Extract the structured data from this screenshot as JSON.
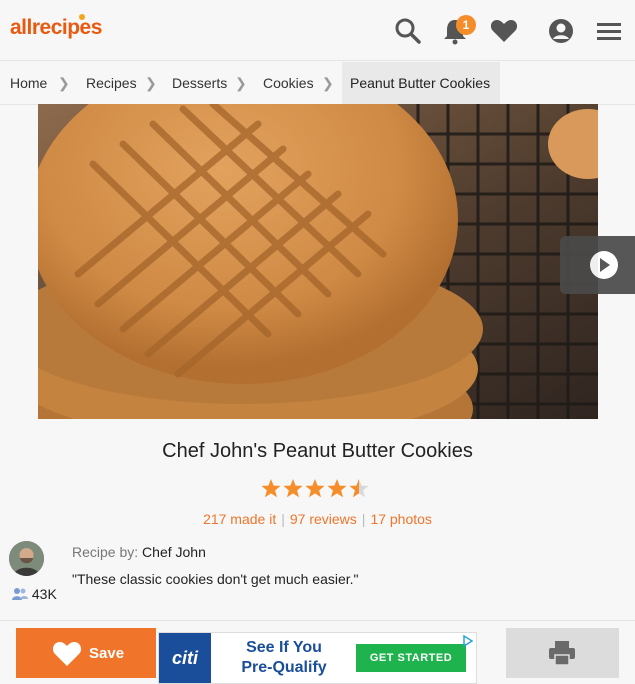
{
  "header": {
    "logo_text": "allrecipes",
    "notification_count": "1",
    "icons": [
      "search-icon",
      "bell-icon",
      "heart-icon",
      "user-icon",
      "menu-icon"
    ]
  },
  "breadcrumbs": {
    "items": [
      "Home",
      "Recipes",
      "Desserts",
      "Cookies"
    ],
    "current": "Peanut Butter Cookies"
  },
  "recipe": {
    "title": "Chef John's Peanut Butter Cookies",
    "rating": 4.5,
    "made_it": "217 made it",
    "reviews": "97 reviews",
    "photos": "17 photos",
    "by_label": "Recipe by:",
    "author": "Chef John",
    "quote": "\"These classic cookies don't get much easier.\"",
    "followers": "43K"
  },
  "footer": {
    "save_label": "Save",
    "ad": {
      "brand": "citi",
      "line1": "See If You",
      "line2": "Pre-Qualify",
      "cta": "GET STARTED"
    }
  },
  "colors": {
    "brand_orange": "#f0752a",
    "star_orange": "#f58d2a",
    "ad_blue": "#1a4e9b",
    "ad_green": "#1fb34d"
  }
}
